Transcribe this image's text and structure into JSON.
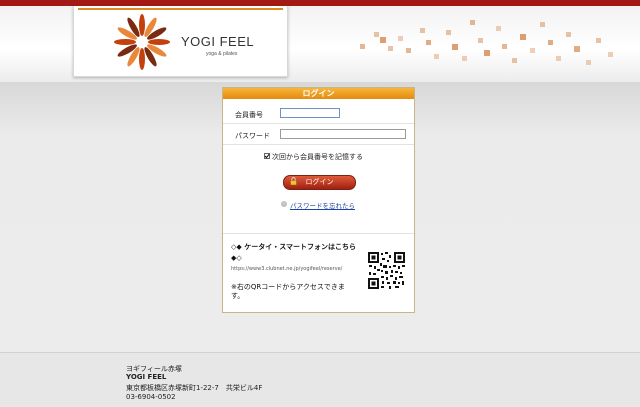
{
  "header": {
    "brand_name": "YOGI FEEL",
    "brand_tagline": "yoga & pilates",
    "colors": {
      "top_bar": "#a31a14",
      "accent": "#e08a24"
    }
  },
  "login": {
    "title": "ログイン",
    "member_label": "会員番号",
    "member_value": "",
    "password_label": "パスワード",
    "password_value": "",
    "remember_label": "次回から会員番号を記憶する",
    "remember_checked": true,
    "login_button": "ログイン",
    "forgot_link": "パスワードを忘れたら",
    "mobile_title_1": "◇◆ ケータイ・スマートフォンはこちら",
    "mobile_title_2": "◆◇",
    "mobile_url": "https://www3.clubnet.ne.jp/yogifeel/reserve/",
    "qr_note": "※右のQRコードからアクセスできます。"
  },
  "footer": {
    "shop_name_kana": "ヨギフィール赤塚",
    "shop_name": "YOGI FEEL",
    "address": "東京都板橋区赤塚新町1-22-7　共栄ビル4F",
    "phone": "03-6904-0502"
  }
}
